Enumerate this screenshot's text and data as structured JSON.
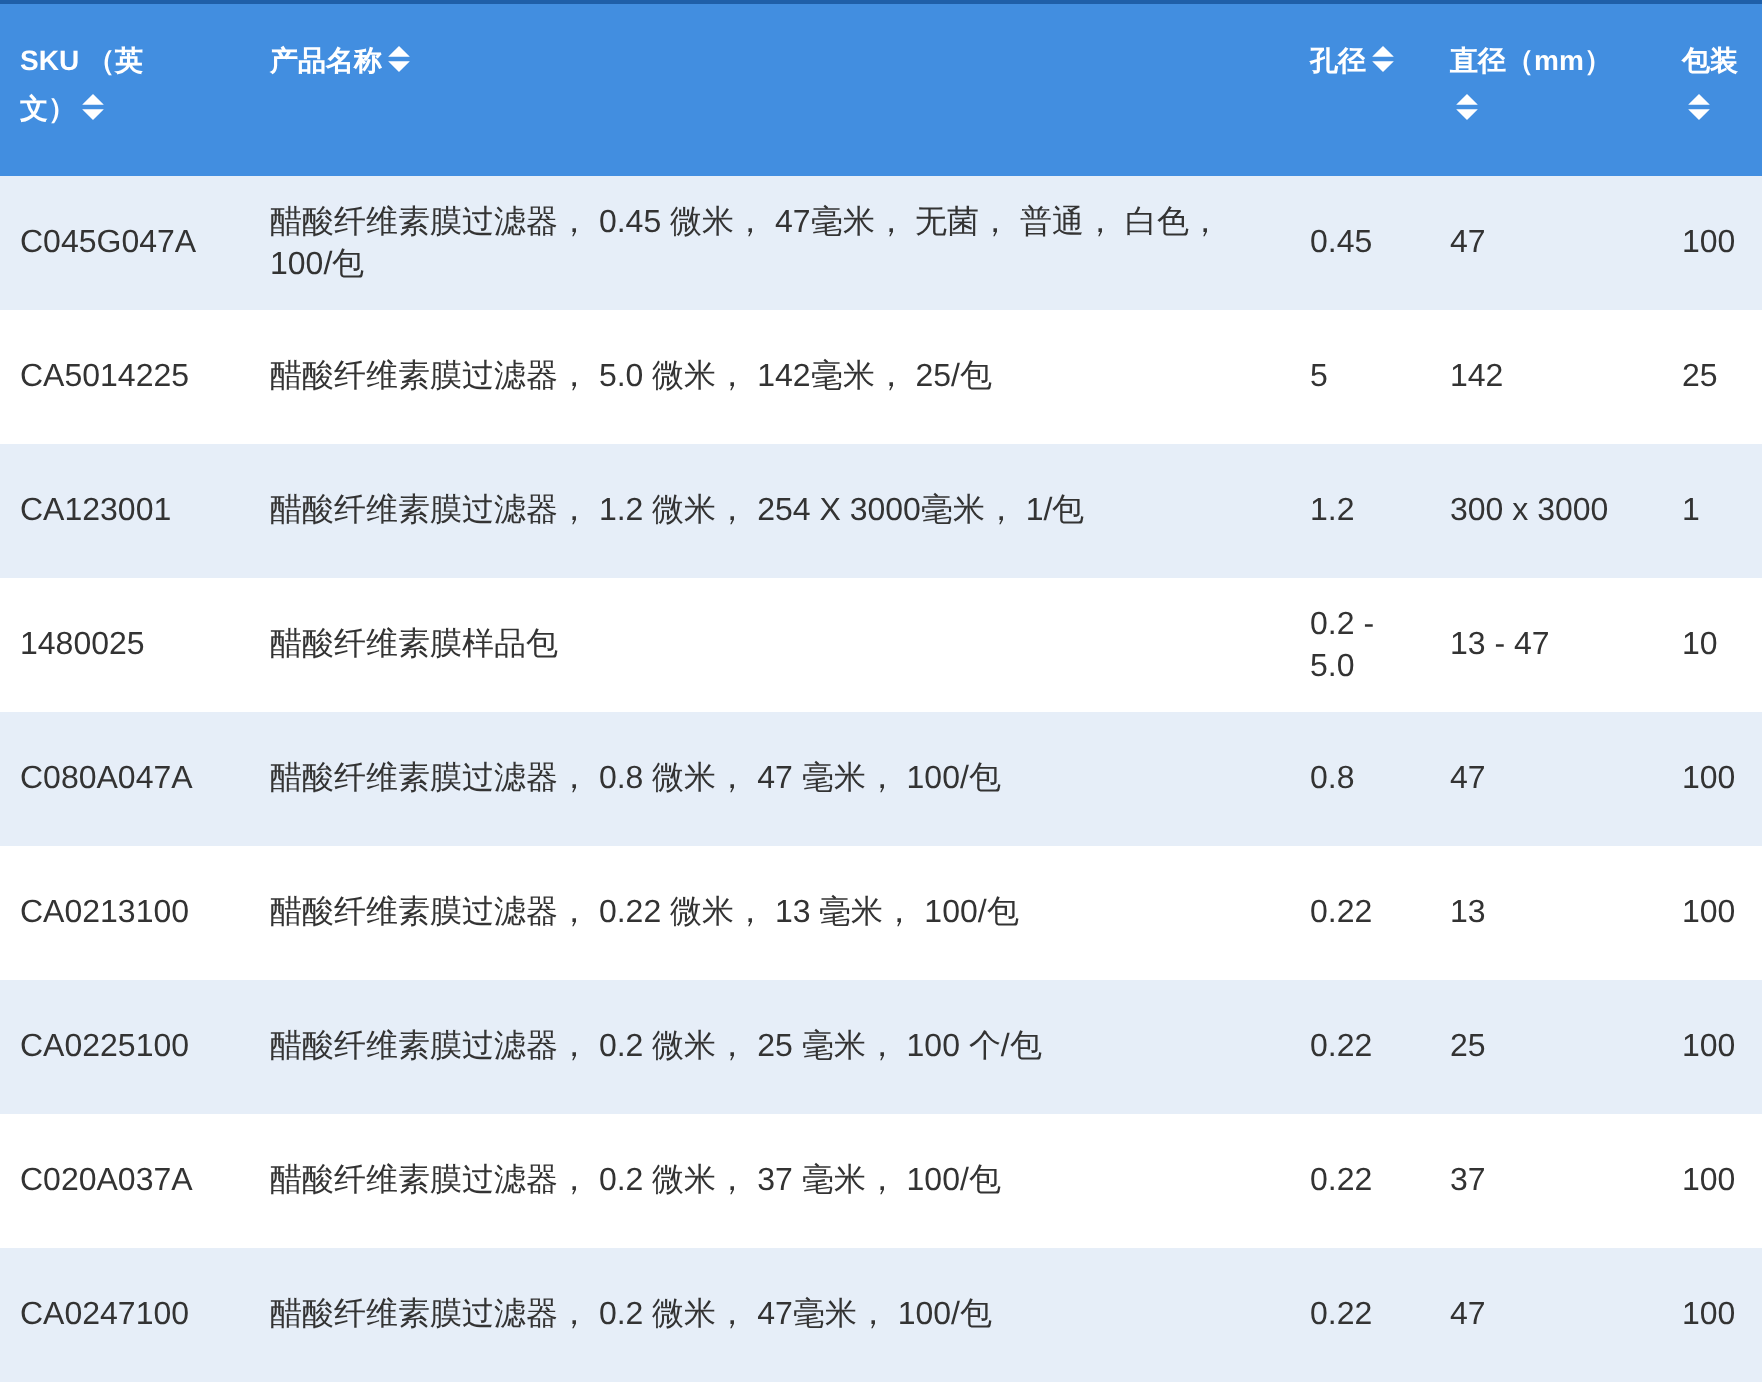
{
  "table": {
    "columns": [
      {
        "kind": "sku",
        "label": "SKU （英文）"
      },
      {
        "kind": "name",
        "label": "产品名称"
      },
      {
        "kind": "pore",
        "label": "孔径"
      },
      {
        "kind": "diameter",
        "label": "直径（mm）"
      },
      {
        "kind": "pack",
        "label": "包装"
      }
    ],
    "rows": [
      [
        "C045G047A",
        "醋酸纤维素膜过滤器， 0.45 微米， 47毫米， 无菌， 普通， 白色， 100/包",
        "0.45",
        "47",
        "100"
      ],
      [
        "CA5014225",
        "醋酸纤维素膜过滤器， 5.0 微米， 142毫米， 25/包",
        "5",
        "142",
        "25"
      ],
      [
        "CA123001",
        "醋酸纤维素膜过滤器， 1.2 微米， 254 X 3000毫米， 1/包",
        "1.2",
        "300 x 3000",
        "1"
      ],
      [
        "1480025",
        "醋酸纤维素膜样品包",
        "0.2 - 5.0",
        "13 - 47",
        "10"
      ],
      [
        "C080A047A",
        "醋酸纤维素膜过滤器， 0.8 微米， 47 毫米， 100/包",
        "0.8",
        "47",
        "100"
      ],
      [
        "CA0213100",
        "醋酸纤维素膜过滤器， 0.22 微米， 13 毫米， 100/包",
        "0.22",
        "13",
        "100"
      ],
      [
        "CA0225100",
        "醋酸纤维素膜过滤器， 0.2 微米， 25 毫米， 100 个/包",
        "0.22",
        "25",
        "100"
      ],
      [
        "C020A037A",
        "醋酸纤维素膜过滤器， 0.2 微米， 37 毫米， 100/包",
        "0.22",
        "37",
        "100"
      ],
      [
        "CA0247100",
        "醋酸纤维素膜过滤器， 0.2 微米， 47毫米， 100/包",
        "0.22",
        "47",
        "100"
      ]
    ]
  }
}
